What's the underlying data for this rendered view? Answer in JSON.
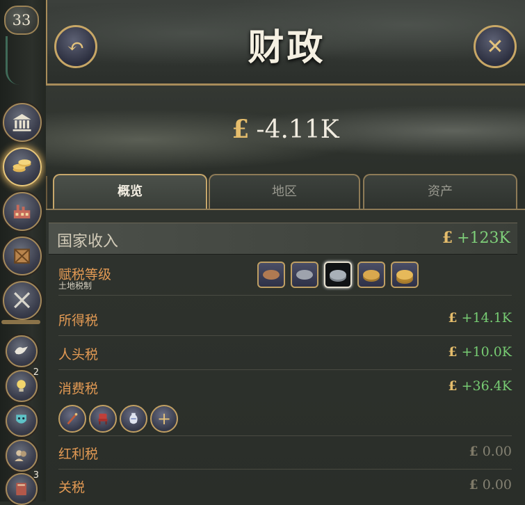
{
  "date_badge": "33",
  "header": {
    "title": "财政"
  },
  "treasury": {
    "symbol": "£",
    "value": "-4.11K"
  },
  "tabs": [
    {
      "label": "概览",
      "active": true
    },
    {
      "label": "地区",
      "active": false
    },
    {
      "label": "资产",
      "active": false
    }
  ],
  "income": {
    "label": "国家收入",
    "symbol": "£",
    "value": "+123K",
    "tax_level": {
      "label": "赋税等级",
      "sublabel": "土地税制",
      "options": 5,
      "selected_index": 2
    },
    "rows": [
      {
        "label": "所得税",
        "symbol": "£",
        "value": "+14.1K"
      },
      {
        "label": "人头税",
        "symbol": "£",
        "value": "+10.0K"
      },
      {
        "label": "消费税",
        "symbol": "£",
        "value": "+36.4K"
      }
    ],
    "goods_icons": [
      "musket-icon",
      "furniture-icon",
      "porcelain-icon",
      "add-icon"
    ],
    "rows_after": [
      {
        "label": "红利税",
        "symbol": "£",
        "value": "0.00"
      },
      {
        "label": "关税",
        "symbol": "£",
        "value": "0.00"
      }
    ]
  },
  "sidebar": {
    "items": [
      "government-icon",
      "treasury-icon",
      "industry-icon",
      "market-icon",
      "military-icon"
    ],
    "small_items": [
      {
        "icon": "diplomacy-icon",
        "badge": ""
      },
      {
        "icon": "tech-icon",
        "badge": "2"
      },
      {
        "icon": "culture-icon",
        "badge": ""
      },
      {
        "icon": "population-icon",
        "badge": ""
      },
      {
        "icon": "journal-icon",
        "badge": "3"
      }
    ]
  },
  "colors": {
    "gold": "#e5bd6c",
    "positive": "#77cc73",
    "label": "#e39a54"
  }
}
